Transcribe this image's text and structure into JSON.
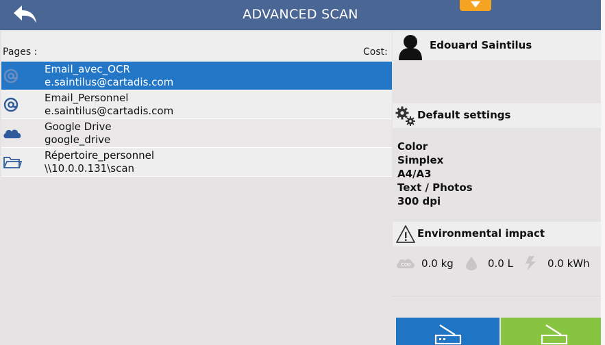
{
  "header": {
    "title": "ADVANCED SCAN",
    "back_icon": "back-arrow-icon",
    "dropdown_icon": "chevron-down-icon"
  },
  "left": {
    "pages_label": "Pages :",
    "cost_label": "Cost:",
    "destinations": [
      {
        "name": "Email_avec_OCR",
        "detail": "e.saintilus@cartadis.com",
        "icon": "at-icon",
        "selected": true
      },
      {
        "name": "Email_Personnel",
        "detail": "e.saintilus@cartadis.com",
        "icon": "at-icon",
        "selected": false
      },
      {
        "name": "Google Drive",
        "detail": "google_drive",
        "icon": "cloud-icon",
        "selected": false
      },
      {
        "name": "Répertoire_personnel",
        "detail": "\\\\10.0.0.131\\scan",
        "icon": "folder-icon",
        "selected": false
      }
    ]
  },
  "right": {
    "user_name": "Edouard Saintilus",
    "settings_title": "Default settings",
    "settings": [
      "Color",
      "Simplex",
      "A4/A3",
      "Text / Photos",
      "300 dpi"
    ],
    "env_title": "Environmental impact",
    "env": {
      "co2": "0.0 kg",
      "water": "0.0 L",
      "energy": "0.0 kWh"
    }
  },
  "colors": {
    "header": "#4a6694",
    "selected": "#2477c6",
    "accent_orange": "#f5a421",
    "scan_blue": "#1f74c4",
    "scan_green": "#87c440"
  }
}
